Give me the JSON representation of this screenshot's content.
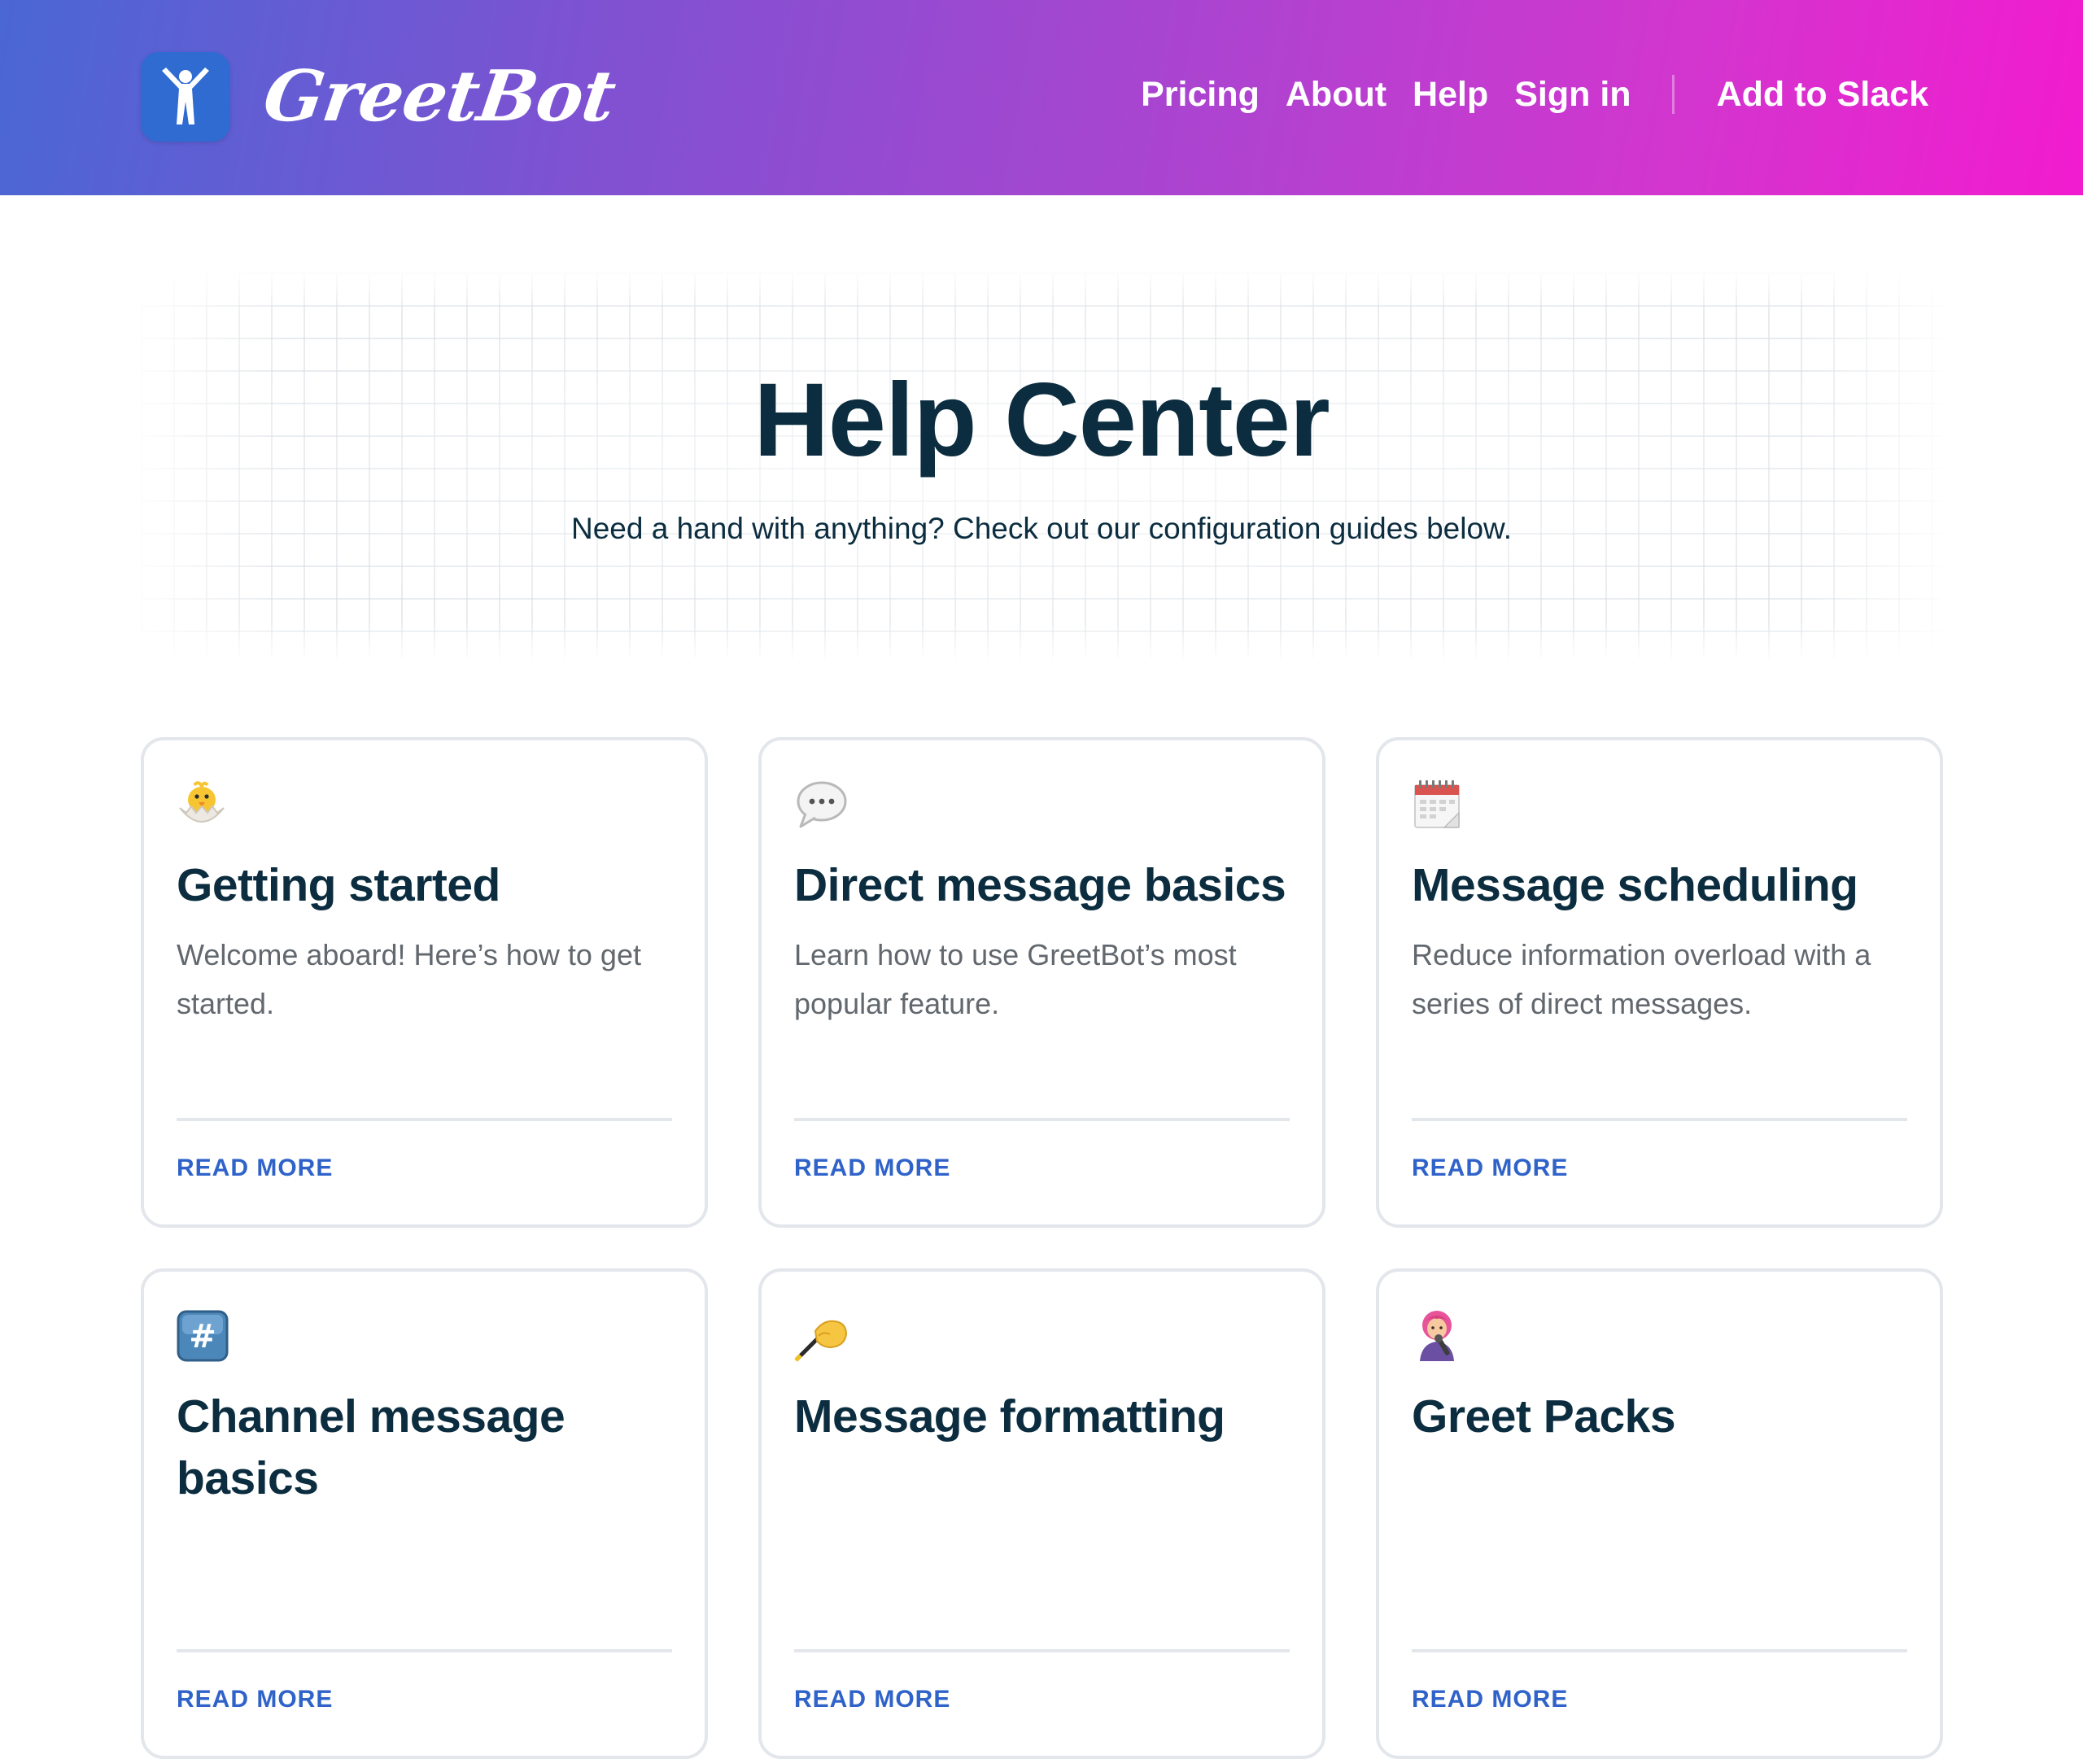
{
  "header": {
    "brand_name": "GreetBot",
    "nav": [
      {
        "label": "Pricing"
      },
      {
        "label": "About"
      },
      {
        "label": "Help"
      },
      {
        "label": "Sign in"
      }
    ],
    "cta_label": "Add to Slack"
  },
  "hero": {
    "title": "Help Center",
    "subtitle": "Need a hand with anything? Check out our configuration guides below."
  },
  "cards": [
    {
      "icon": "hatching-chick-icon",
      "title": "Getting started",
      "description": "Welcome aboard! Here’s how to get started.",
      "link_label": "READ MORE"
    },
    {
      "icon": "speech-bubble-icon",
      "title": "Direct message basics",
      "description": "Learn how to use GreetBot’s most popular feature.",
      "link_label": "READ MORE"
    },
    {
      "icon": "spiral-calendar-icon",
      "title": "Message scheduling",
      "description": "Reduce information overload with a series of direct messages.",
      "link_label": "READ MORE"
    },
    {
      "icon": "hash-keycap-icon",
      "title": "Channel message basics",
      "description": "",
      "link_label": "READ MORE"
    },
    {
      "icon": "writing-hand-icon",
      "title": "Message formatting",
      "description": "",
      "link_label": "READ MORE"
    },
    {
      "icon": "singer-icon",
      "title": "Greet Packs",
      "description": "",
      "link_label": "READ MORE"
    }
  ],
  "colors": {
    "header_gradient_start": "#4a67d4",
    "header_gradient_end": "#f21bcf",
    "logo_tile": "#2f6bd1",
    "heading_text": "#0b2d3f",
    "body_text": "#62686e",
    "link": "#2f63c9",
    "card_border": "#e3e6ea"
  }
}
